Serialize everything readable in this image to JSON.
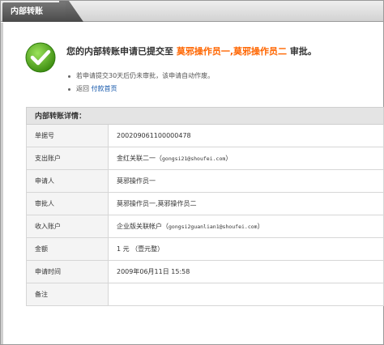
{
  "tab": {
    "label": "内部转账"
  },
  "headline": {
    "prefix": "您的内部转账申请已提交至",
    "approvers": "莫邪操作员一,莫邪操作员二",
    "suffix": "审批。"
  },
  "notes": [
    {
      "text": "若申请提交30天后仍未审批，该申请自动作废。"
    },
    {
      "text_prefix": "返回",
      "link": "付款首页"
    }
  ],
  "details": {
    "title": "内部转账详情：",
    "rows": [
      {
        "label": "单据号",
        "value": "200209061100000478"
      },
      {
        "label": "支出账户",
        "value": "金红关联二一（",
        "mono": "gongsi21@shoufei.com",
        "value_end": "）"
      },
      {
        "label": "申请人",
        "value": "莫邪操作员一"
      },
      {
        "label": "审批人",
        "value": "莫邪操作员一,莫邪操作员二"
      },
      {
        "label": "收入账户",
        "value": "企业版关联帐户（",
        "mono": "gongsi2guanlian1@shoufei.com",
        "value_end": "）"
      },
      {
        "label": "金额",
        "value": "1 元 （壹元整）"
      },
      {
        "label": "申请时间",
        "value": "2009年06月11日 15:58"
      },
      {
        "label": "备注",
        "value": ""
      }
    ]
  },
  "colors": {
    "highlight": "#ff6600",
    "link": "#1155aa",
    "check": "#5aaa1e"
  }
}
